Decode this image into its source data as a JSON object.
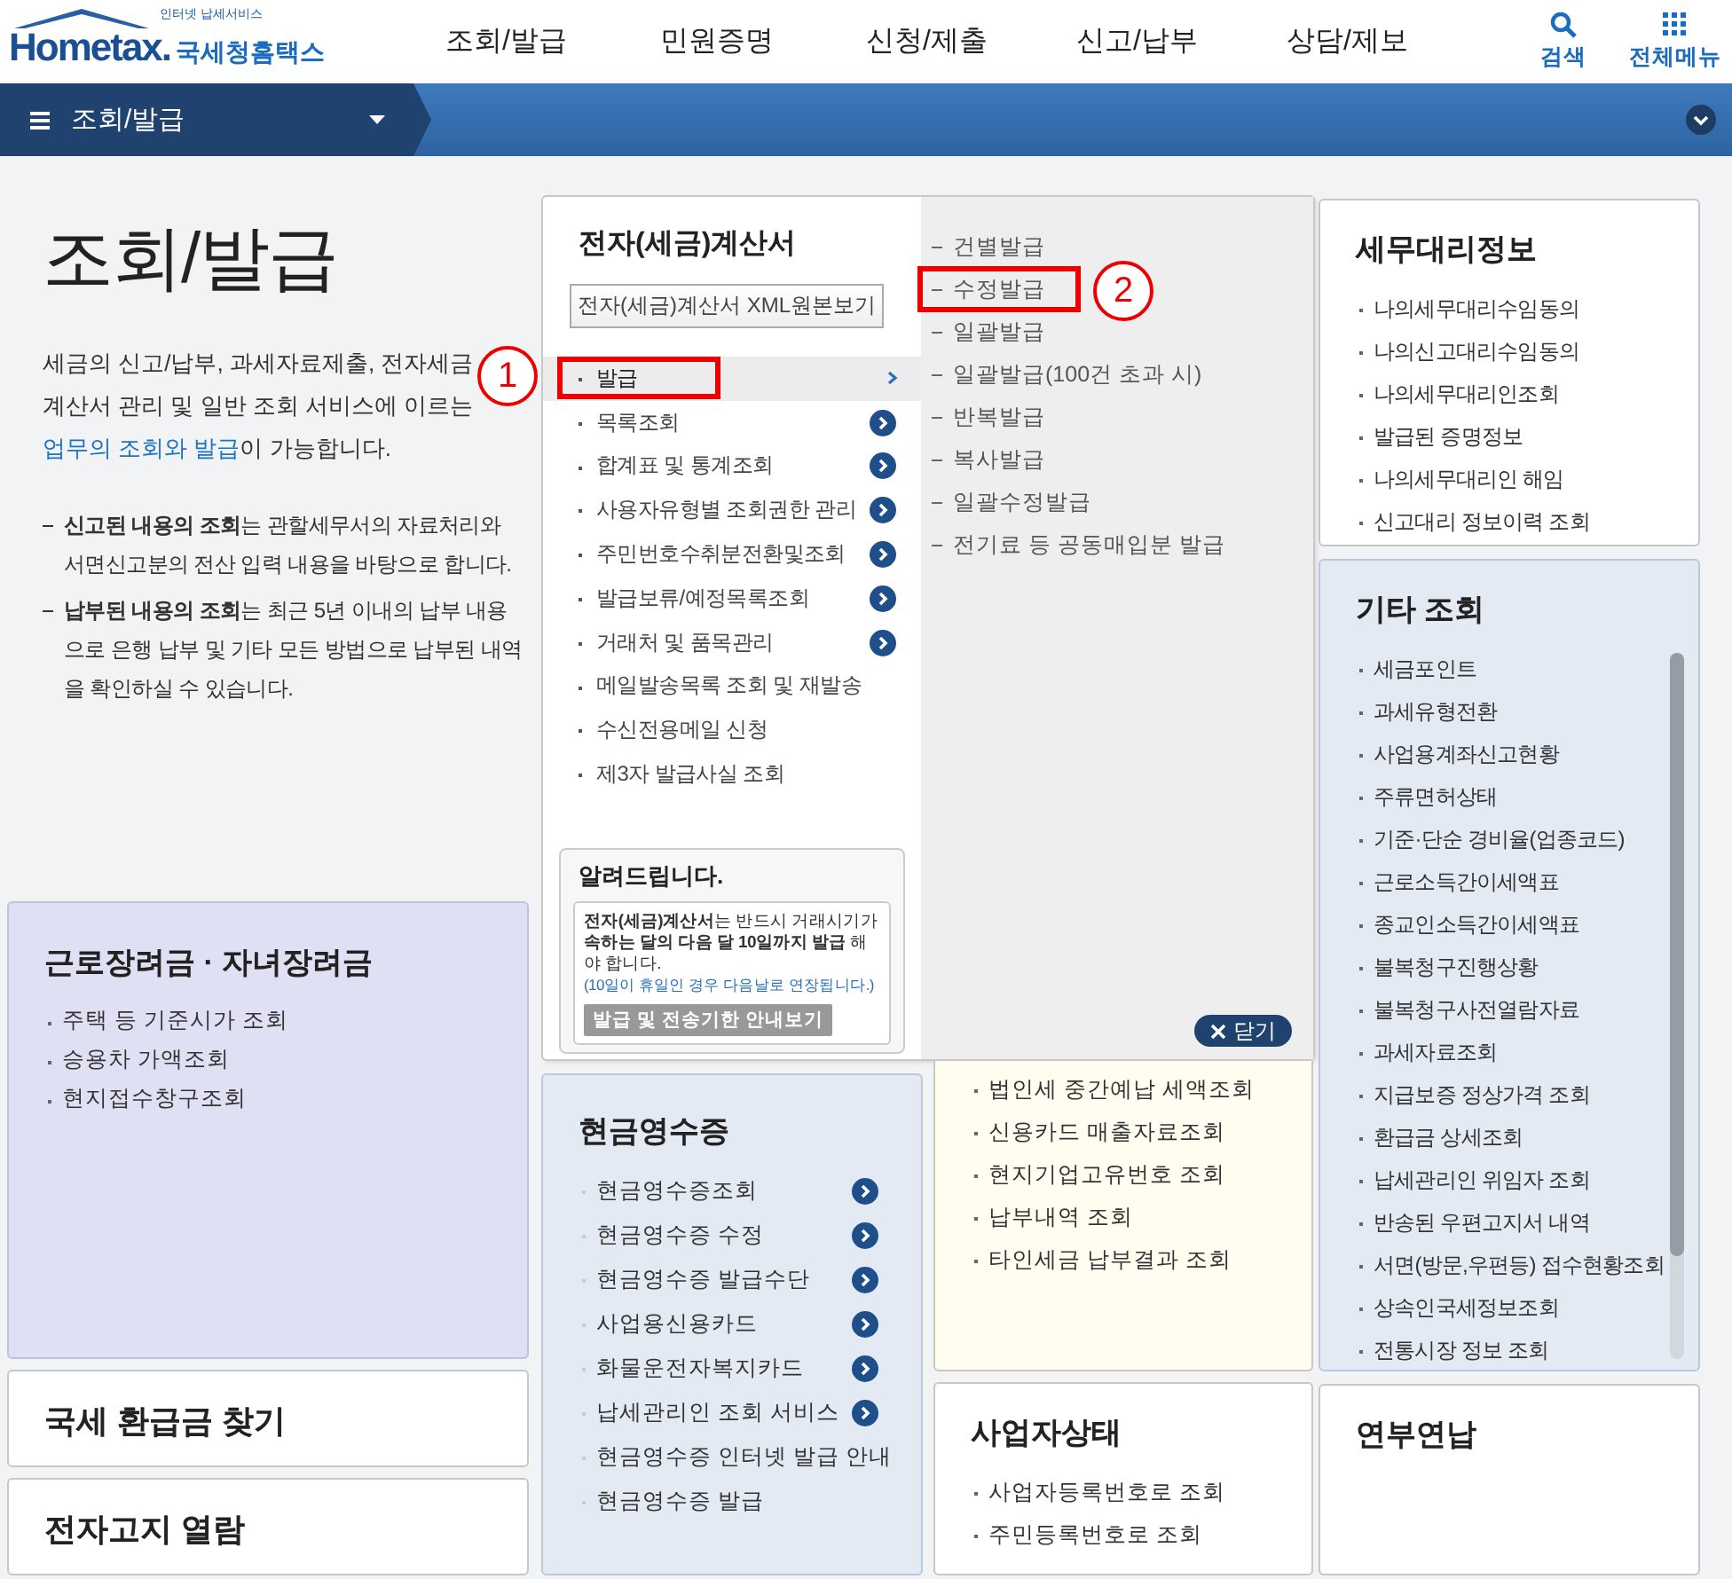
{
  "header": {
    "logo": {
      "tagline": "인터넷 납세서비스",
      "wordmark": "Hometax.",
      "service_name": "국세청홈택스"
    },
    "nav": [
      {
        "label": "조회/발급"
      },
      {
        "label": "민원증명"
      },
      {
        "label": "신청/제출"
      },
      {
        "label": "신고/납부"
      },
      {
        "label": "상담/제보"
      }
    ],
    "tools": [
      {
        "label": "검색",
        "kind": "search"
      },
      {
        "label": "전체메뉴",
        "kind": "grid"
      }
    ]
  },
  "breadcrumb_bar": {
    "current": "조회/발급"
  },
  "intro": {
    "title": "조회/발급",
    "description": [
      {
        "kind": "text",
        "text": "세금의 신고/납부, 과세자료제출, 전자세금계산서 관리 및 일반 조회 서비스에 이르는 "
      },
      {
        "kind": "link",
        "text": "업무의 조회와 발급"
      },
      {
        "kind": "text",
        "text": "이 가능합니다."
      }
    ],
    "notes": [
      "**신고된 내용의 조회**는 관할세무서의 자료처리와 서면신고분의 전산 입력 내용을 바탕으로 합니다.",
      "**납부된 내용의 조회**는 최근 5년 이내의 납부 내용으로 은행 납부 및 기타 모든 방법으로 납부된 내역을 확인하실 수 있습니다."
    ]
  },
  "left_cards": [
    {
      "title": "근로장려금 · 자녀장려금",
      "items": [
        {
          "label": "주택 등 기준시가 조회"
        },
        {
          "label": "승용차 가액조회"
        },
        {
          "label": "현지접수창구조회"
        }
      ]
    },
    {
      "title": "국세 환급금 찾기"
    },
    {
      "title": "전자고지 열람"
    }
  ],
  "dropdown": {
    "title": "전자(세금)계산서",
    "xml_button": "전자(세금)계산서 XML원본보기",
    "items": [
      {
        "label": "발급",
        "kind": "submenu",
        "selected": true,
        "marker": "1"
      },
      {
        "label": "목록조회",
        "kind": "more",
        "selected": false
      },
      {
        "label": "합계표 및 통계조회",
        "kind": "more",
        "selected": false
      },
      {
        "label": "사용자유형별 조회권한 관리",
        "kind": "more",
        "selected": false
      },
      {
        "label": "주민번호수취분전환및조회",
        "kind": "more",
        "selected": false
      },
      {
        "label": "발급보류/예정목록조회",
        "kind": "more",
        "selected": false
      },
      {
        "label": "거래처 및 품목관리",
        "kind": "more",
        "selected": false
      },
      {
        "label": "메일발송목록 조회 및 재발송",
        "kind": "plain",
        "selected": false
      },
      {
        "label": "수신전용메일 신청",
        "kind": "plain",
        "selected": false
      },
      {
        "label": "제3자 발급사실 조회",
        "kind": "plain",
        "selected": false
      }
    ],
    "notice": {
      "title": "알려드립니다.",
      "text": "**전자(세금)계산서**는 반드시 거래시기가 **속하는 달의 다음 달 10일까지 발급** 해야 합니다.",
      "note": "(10일이 휴일인 경우 다음날로 연장됩니다.)",
      "button": "발급 및 전송기한 안내보기"
    },
    "submenu": [
      {
        "label": "건별발급"
      },
      {
        "label": "수정발급",
        "marker": "2"
      },
      {
        "label": "일괄발급"
      },
      {
        "label": "일괄발급(100건 초과 시)"
      },
      {
        "label": "반복발급"
      },
      {
        "label": "복사발급"
      },
      {
        "label": "일괄수정발급"
      },
      {
        "label": "전기료 등 공동매입분 발급"
      }
    ],
    "close_button": "닫기"
  },
  "middle_cards": [
    {
      "title": "현금영수증",
      "items": [
        {
          "label": "현금영수증조회",
          "kind": "more"
        },
        {
          "label": "현금영수증 수정",
          "kind": "more"
        },
        {
          "label": "현금영수증 발급수단",
          "kind": "more"
        },
        {
          "label": "사업용신용카드",
          "kind": "more"
        },
        {
          "label": "화물운전자복지카드",
          "kind": "more"
        },
        {
          "label": "납세관리인 조회 서비스",
          "kind": "more"
        },
        {
          "label": "현금영수증 인터넷 발급 안내",
          "kind": "plain"
        },
        {
          "label": "현금영수증 발급",
          "kind": "plain"
        }
      ]
    },
    {
      "items": [
        {
          "label": "법인세 중간예납 세액조회"
        },
        {
          "label": "신용카드 매출자료조회"
        },
        {
          "label": "현지기업고유번호 조회"
        },
        {
          "label": "납부내역 조회"
        },
        {
          "label": "타인세금 납부결과 조회"
        }
      ]
    },
    {
      "title": "사업자상태",
      "items": [
        {
          "label": "사업자등록번호로 조회"
        },
        {
          "label": "주민등록번호로 조회"
        }
      ]
    }
  ],
  "right_cards": [
    {
      "title": "세무대리정보",
      "items": [
        {
          "label": "나의세무대리수임동의"
        },
        {
          "label": "나의신고대리수임동의"
        },
        {
          "label": "나의세무대리인조회"
        },
        {
          "label": "발급된 증명정보"
        },
        {
          "label": "나의세무대리인 해임"
        },
        {
          "label": "신고대리 정보이력 조회"
        }
      ]
    },
    {
      "title": "기타 조회",
      "scrollable": true,
      "items": [
        {
          "label": "세금포인트"
        },
        {
          "label": "과세유형전환"
        },
        {
          "label": "사업용계좌신고현황"
        },
        {
          "label": "주류면허상태"
        },
        {
          "label": "기준·단순 경비율(업종코드)"
        },
        {
          "label": "근로소득간이세액표"
        },
        {
          "label": "종교인소득간이세액표"
        },
        {
          "label": "불복청구진행상황"
        },
        {
          "label": "불복청구사전열람자료"
        },
        {
          "label": "과세자료조회"
        },
        {
          "label": "지급보증 정상가격 조회"
        },
        {
          "label": "환급금 상세조회"
        },
        {
          "label": "납세관리인 위임자 조회"
        },
        {
          "label": "반송된 우편고지서 내역"
        },
        {
          "label": "서면(방문,우편등) 접수현황조회"
        },
        {
          "label": "상속인국세정보조회"
        },
        {
          "label": "전통시장 정보 조회"
        }
      ]
    },
    {
      "title": "연부연납"
    }
  ]
}
